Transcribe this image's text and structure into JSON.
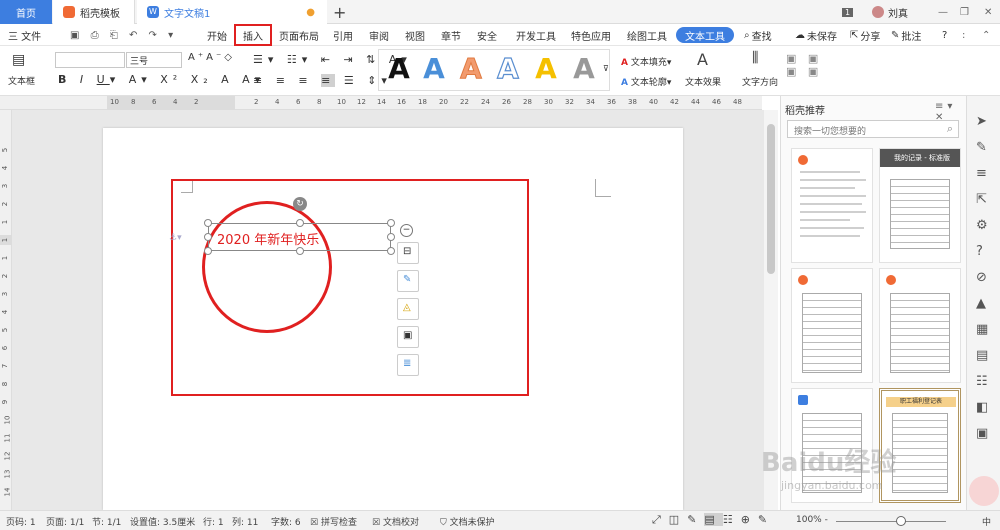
{
  "titlebar": {
    "tab_home": "首页",
    "tab_templates": "稻壳模板",
    "tab_doc": "文字文稿1",
    "add_tab": "+",
    "page_count": "1",
    "user": "刘真"
  },
  "menubar": {
    "file": "三 文件",
    "items": [
      "开始",
      "插入",
      "页面布局",
      "引用",
      "审阅",
      "视图",
      "章节",
      "安全",
      "开发工具",
      "特色应用",
      "绘图工具",
      "文本工具"
    ],
    "search": "查找",
    "unsaved": "未保存",
    "share": "分享",
    "comment": "批注",
    "help": "?"
  },
  "ribbon": {
    "textbox": "文本框",
    "font_size": "三号",
    "text_fill": "文本填充",
    "text_outline": "文本轮廓",
    "text_effects": "文本效果",
    "text_direction": "文字方向"
  },
  "ruler": {
    "h_ticks": [
      "10",
      "8",
      "6",
      "4",
      "2",
      "2",
      "4",
      "6",
      "8",
      "10",
      "12",
      "14",
      "16",
      "18",
      "20",
      "22",
      "24",
      "26",
      "28",
      "30",
      "32",
      "34",
      "36",
      "38",
      "40",
      "42",
      "44",
      "46",
      "48"
    ],
    "v_ticks": [
      "5",
      "4",
      "3",
      "2",
      "1",
      "1",
      "1",
      "2",
      "3",
      "4",
      "5",
      "6",
      "7",
      "8",
      "9",
      "10",
      "11",
      "12",
      "13",
      "14",
      "15",
      "16"
    ]
  },
  "document": {
    "textbox_content": "2020 年新年快乐"
  },
  "panel": {
    "title": "稻壳推荐",
    "search_placeholder": "搜索一切您想要的",
    "card_title": "我的记录 - 标准版",
    "card_title2": "职工福利登记表"
  },
  "watermark": {
    "brand": "Baidu经验",
    "url": "jingyan.baidu.com"
  },
  "status": {
    "page_num": "页码: 1",
    "pages": "页面: 1/1",
    "section": "节: 1/1",
    "setting": "设置值: 3.5厘米",
    "row": "行: 1",
    "col": "列: 11",
    "words": "字数: 6",
    "spell": "拼写检查",
    "proof": "文档校对",
    "protect": "文档未保护",
    "zoom": "100% -",
    "lang": "中"
  },
  "colors": {
    "accent": "#3d7ee0",
    "highlight": "#e02020",
    "text_red": "#e02020"
  }
}
